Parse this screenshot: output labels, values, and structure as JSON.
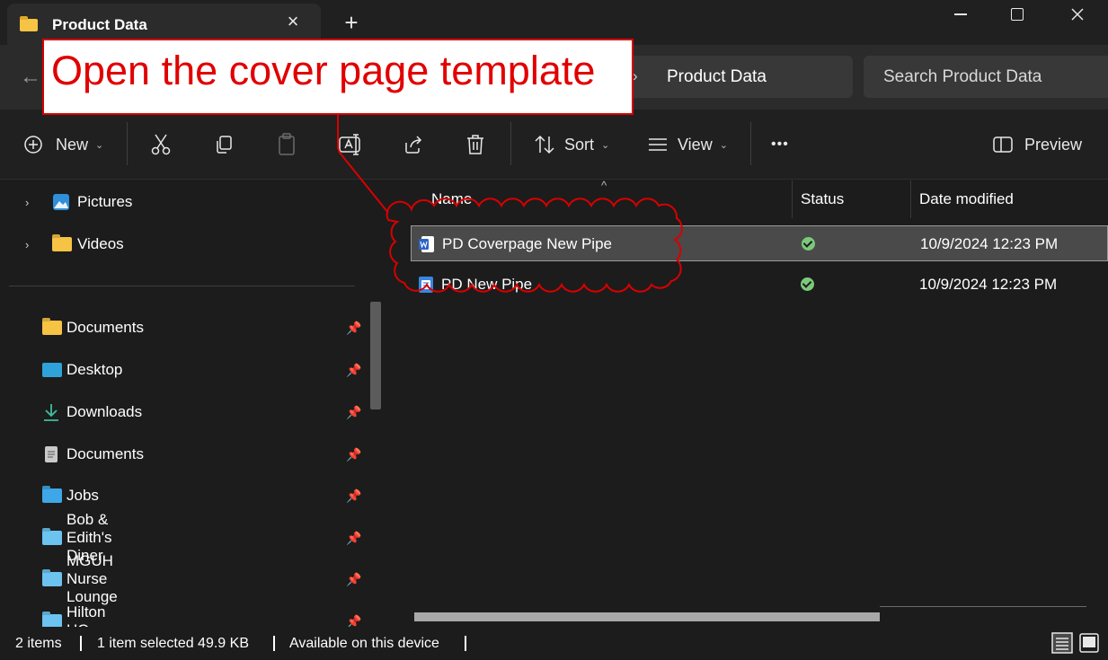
{
  "window": {
    "tab_title": "Product Data",
    "tab_close": "×",
    "new_tab": "+"
  },
  "address": {
    "breadcrumb_separator": "›",
    "current_folder": "Product Data",
    "search_placeholder": "Search Product Data"
  },
  "toolbar": {
    "new_label": "New",
    "sort_label": "Sort",
    "view_label": "View",
    "more_label": "•••",
    "preview_label": "Preview"
  },
  "sidebar": {
    "tree_items": [
      {
        "label": "Pictures",
        "icon": "pictures-icon"
      },
      {
        "label": "Videos",
        "icon": "videos-folder-icon"
      }
    ],
    "quick_access": [
      {
        "label": "Documents",
        "icon": "folder-icon",
        "color": "#f6c344"
      },
      {
        "label": "Desktop",
        "icon": "desktop-icon",
        "color": "#2fa3d9"
      },
      {
        "label": "Downloads",
        "icon": "download-icon",
        "color": "#3fbf9f"
      },
      {
        "label": "Documents",
        "icon": "document-icon",
        "color": "#c9c9c9"
      },
      {
        "label": "Jobs",
        "icon": "folder-icon",
        "color": "#3ea7e8"
      },
      {
        "label": "Bob & Edith's Diner",
        "icon": "folder-icon",
        "color": "#6cc3f0"
      },
      {
        "label": "MGUH Nurse Lounge",
        "icon": "folder-icon",
        "color": "#6cc3f0"
      },
      {
        "label": "Hilton HQ",
        "icon": "folder-icon",
        "color": "#6cc3f0"
      }
    ]
  },
  "columns": {
    "name": "Name",
    "status": "Status",
    "date_modified": "Date modified"
  },
  "files": [
    {
      "name": "PD Coverpage New Pipe",
      "type": "word-document-icon",
      "date": "10/9/2024 12:23 PM",
      "selected": true
    },
    {
      "name": "PD New Pipe",
      "type": "document-icon",
      "date": "10/9/2024 12:23 PM",
      "selected": false
    }
  ],
  "statusbar": {
    "item_count": "2 items",
    "selection": "1 item selected  49.9 KB",
    "availability": "Available on this device"
  },
  "annotation": {
    "callout_text": "Open the cover page template",
    "color": "#e10000"
  }
}
